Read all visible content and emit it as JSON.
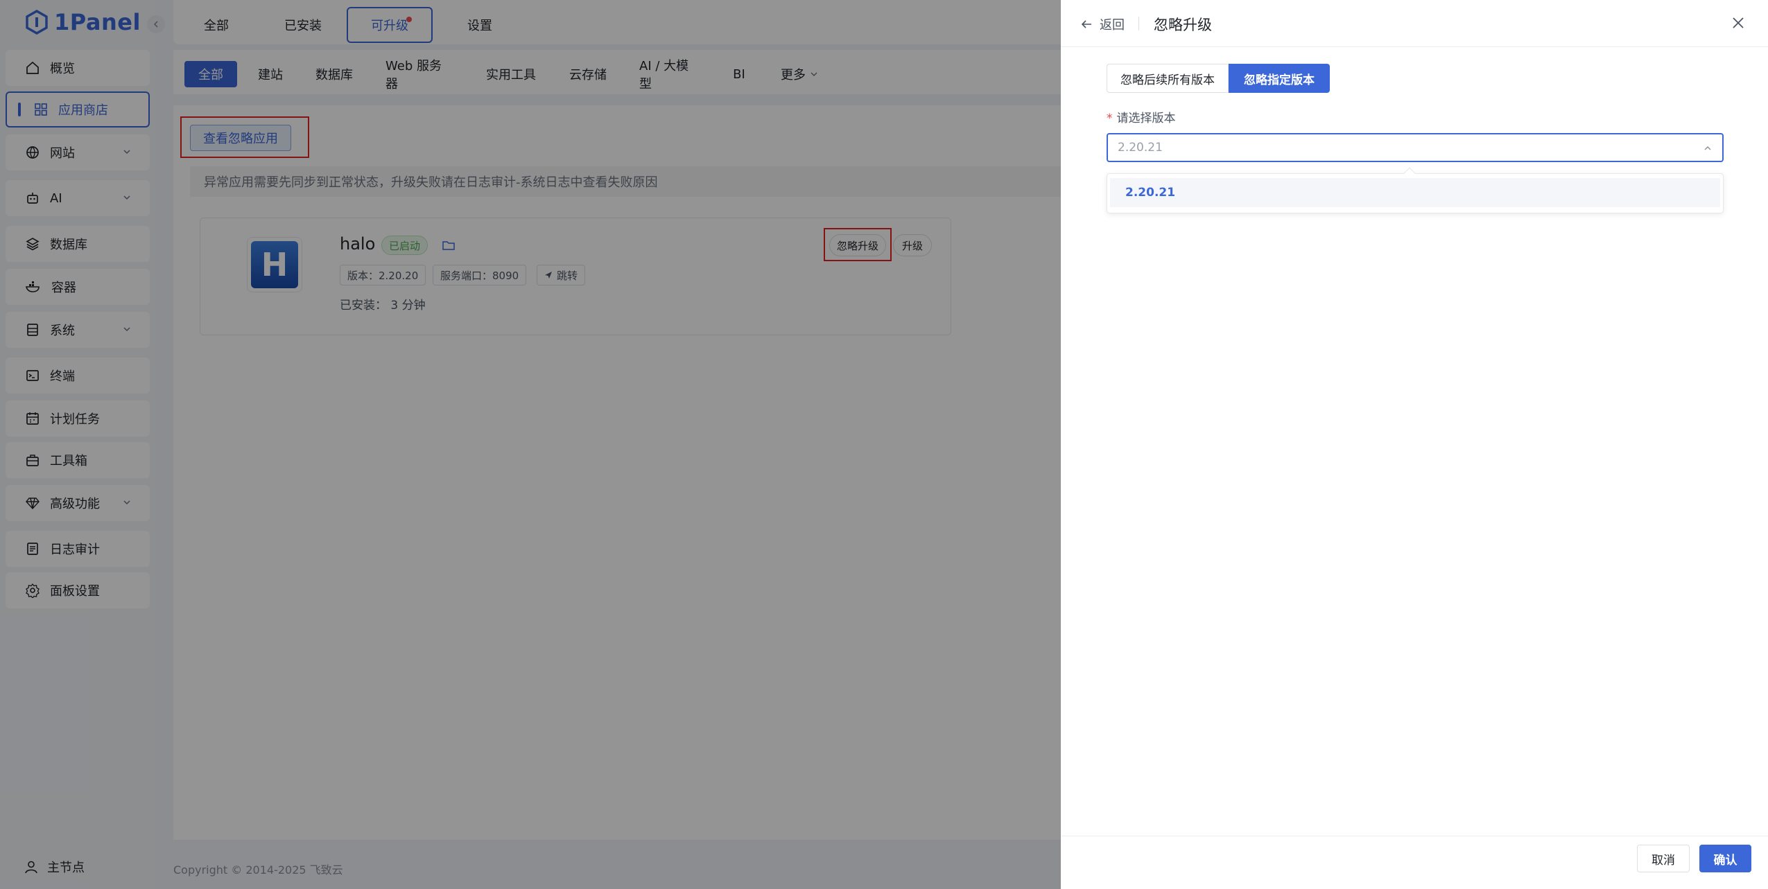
{
  "brand": {
    "name": "1Panel",
    "color": "#3b67d8"
  },
  "sidebar": {
    "items": [
      {
        "label": "概览",
        "icon": "home-icon"
      },
      {
        "label": "应用商店",
        "icon": "grid-icon",
        "active": true
      },
      {
        "label": "网站",
        "icon": "globe-icon",
        "expandable": true
      },
      {
        "label": "AI",
        "icon": "robot-icon",
        "expandable": true
      },
      {
        "label": "数据库",
        "icon": "layers-icon"
      },
      {
        "label": "容器",
        "icon": "docker-icon"
      },
      {
        "label": "系统",
        "icon": "server-icon",
        "expandable": true
      },
      {
        "label": "终端",
        "icon": "terminal-icon"
      },
      {
        "label": "计划任务",
        "icon": "calendar-icon"
      },
      {
        "label": "工具箱",
        "icon": "toolbox-icon"
      },
      {
        "label": "高级功能",
        "icon": "diamond-icon",
        "expandable": true
      },
      {
        "label": "日志审计",
        "icon": "log-icon"
      },
      {
        "label": "面板设置",
        "icon": "gear-icon"
      }
    ],
    "footer": {
      "label": "主节点",
      "icon": "user-icon"
    }
  },
  "top_tabs": [
    {
      "label": "全部"
    },
    {
      "label": "已安装"
    },
    {
      "label": "可升级",
      "active": true,
      "has_dot": true
    },
    {
      "label": "设置"
    }
  ],
  "categories": [
    "全部",
    "建站",
    "数据库",
    "Web 服务器",
    "实用工具",
    "云存储",
    "AI / 大模型",
    "BI",
    "更多"
  ],
  "active_category": "全部",
  "content": {
    "ignore_apps_button": "查看忽略应用",
    "notice": "异常应用需要先同步到正常状态，升级失败请在日志审计-系统日志中查看失败原因",
    "app": {
      "icon_letter": "H",
      "name": "halo",
      "status": "已启动",
      "version_tag": "版本：2.20.20",
      "port_tag": "服务端口：8090",
      "jump_tag": "跳转",
      "installed": "已安装：  3 分钟",
      "ignore_upgrade_button": "忽略升级",
      "upgrade_button": "升级"
    },
    "copyright": "Copyright © 2014-2025 飞致云"
  },
  "drawer": {
    "back_label": "返回",
    "title": "忽略升级",
    "segments": {
      "all": "忽略后续所有版本",
      "specific": "忽略指定版本"
    },
    "selected_segment": "specific",
    "field_label": "请选择版本",
    "select_value": "2.20.21",
    "options": [
      "2.20.21"
    ],
    "cancel": "取消",
    "confirm": "确认"
  },
  "colors": {
    "accent": "#3b67d8",
    "highlight_box": "#e52222",
    "status_green": "#47a74c"
  }
}
